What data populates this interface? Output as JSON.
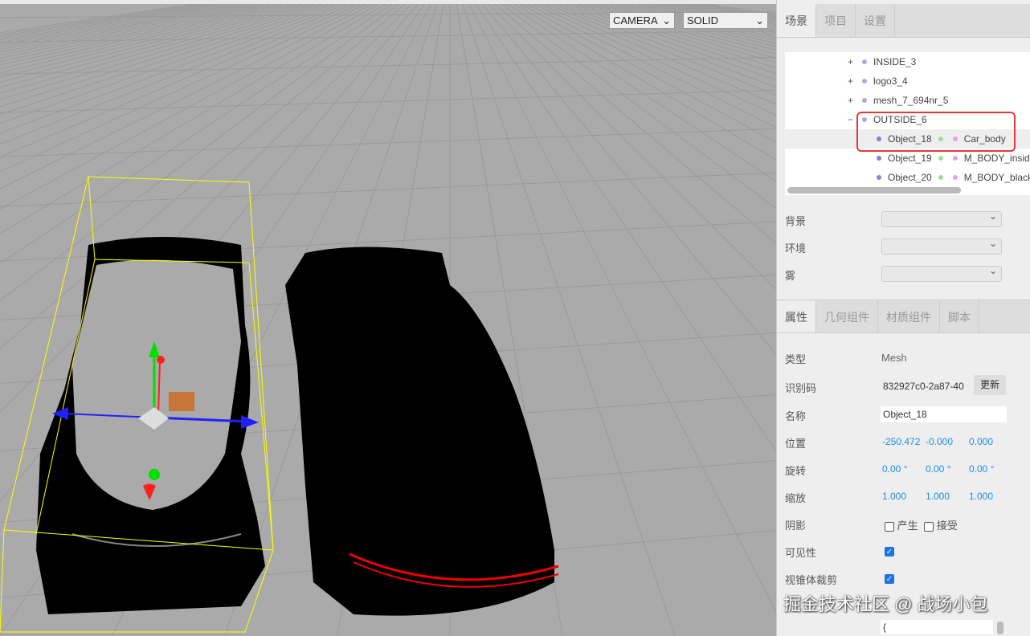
{
  "viewport": {
    "camera_select": "CAMERA",
    "shading_select": "SOLID"
  },
  "sidebar": {
    "tabs": [
      {
        "label": "场景",
        "active": true
      },
      {
        "label": "项目"
      },
      {
        "label": "设置"
      }
    ],
    "outliner": [
      {
        "op": "+",
        "name": "INSIDE_3"
      },
      {
        "op": "+",
        "name": "logo3_4"
      },
      {
        "op": "+",
        "name": "mesh_7_694nr_5"
      },
      {
        "op": "−",
        "name": "OUTSIDE_6"
      },
      {
        "name": "Object_18",
        "material": "Car_body",
        "selected": true
      },
      {
        "name": "Object_19",
        "material": "M_BODY_inside"
      },
      {
        "name": "Object_20",
        "material": "M_BODY_black"
      }
    ],
    "scene_props": [
      {
        "label": "背景"
      },
      {
        "label": "环境"
      },
      {
        "label": "雾"
      }
    ],
    "prop_tabs": [
      {
        "label": "属性",
        "active": true
      },
      {
        "label": "几何组件"
      },
      {
        "label": "材质组件"
      },
      {
        "label": "脚本"
      }
    ],
    "properties": {
      "type_label": "类型",
      "type": "Mesh",
      "uuid_label": "识别码",
      "uuid": "832927c0-2a87-40",
      "update_button": "更新",
      "name_label": "名称",
      "name": "Object_18",
      "position_label": "位置",
      "position": [
        "-250.472",
        "-0.000",
        "0.000"
      ],
      "rotation_label": "旋转",
      "rotation": [
        "0.00 °",
        "0.00 °",
        "0.00 °"
      ],
      "scale_label": "缩放",
      "scale": [
        "1.000",
        "1.000",
        "1.000"
      ],
      "shadow_label": "阴影",
      "shadow_cast": "产生",
      "shadow_receive": "接受",
      "visible_label": "可见性",
      "visible": true,
      "frustum_label": "视锥体裁剪",
      "frustum": true,
      "userdata": "{"
    }
  },
  "watermark": "掘金技术社区 @ 战场小包",
  "colors": {
    "object_dot": "#8b7fd9",
    "geometry_dot": "#9be09b",
    "material_dot": "#e8a0e8",
    "link": "#1a8fe0",
    "highlight": "#e53935"
  }
}
